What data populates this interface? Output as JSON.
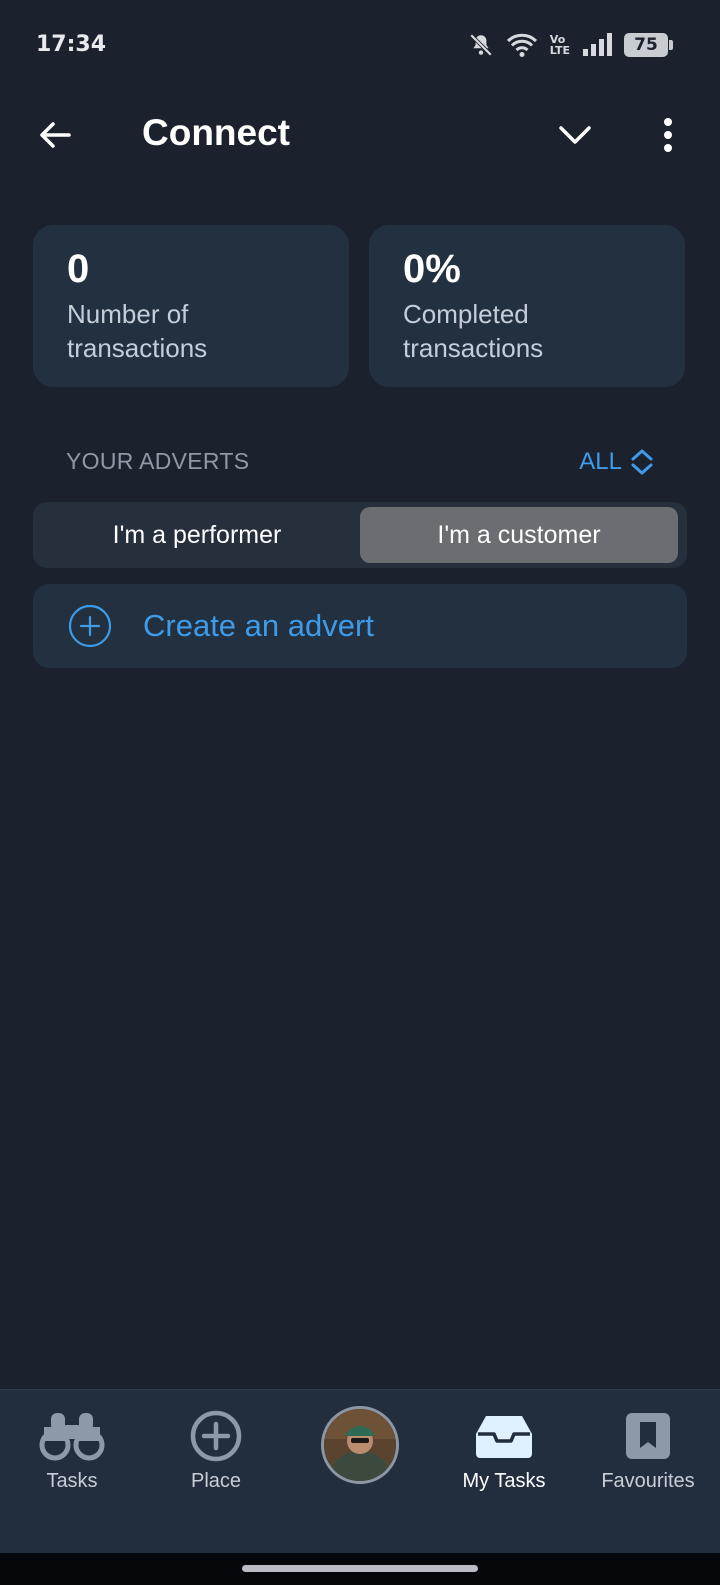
{
  "status_bar": {
    "time": "17:34",
    "icons": [
      "bell-off-icon",
      "wifi-icon",
      "volte-icon",
      "signal-icon",
      "battery-icon"
    ],
    "volte_top": "Vo",
    "volte_bottom": "LTE",
    "battery": "75"
  },
  "app_bar": {
    "title": "Connect",
    "back_icon": "arrow-left-icon",
    "dropdown_icon": "chevron-down-icon",
    "menu_icon": "more-vertical-icon"
  },
  "stats": [
    {
      "value": "0",
      "label_line1": "Number of",
      "label_line2": "transactions"
    },
    {
      "value": "0%",
      "label_line1": "Completed",
      "label_line2": "transactions"
    }
  ],
  "adverts": {
    "header": "YOUR ADVERTS",
    "filter": "ALL",
    "segments": [
      {
        "label": "I'm a performer",
        "selected": false
      },
      {
        "label": "I'm a customer",
        "selected": true
      }
    ],
    "create_label": "Create an advert"
  },
  "bottom_nav": {
    "items": [
      {
        "label": "Tasks",
        "icon": "binoculars-icon",
        "active": false
      },
      {
        "label": "Place",
        "icon": "plus-circle-icon",
        "active": false
      },
      {
        "label": "",
        "icon": "avatar",
        "active": false
      },
      {
        "label": "My Tasks",
        "icon": "inbox-icon",
        "active": true
      },
      {
        "label": "Favourites",
        "icon": "bookmark-icon",
        "active": false
      }
    ]
  },
  "colors": {
    "background": "#1b222d",
    "card": "#22303f",
    "accent": "#3d9be9",
    "segment_selected": "#6a6d71"
  }
}
